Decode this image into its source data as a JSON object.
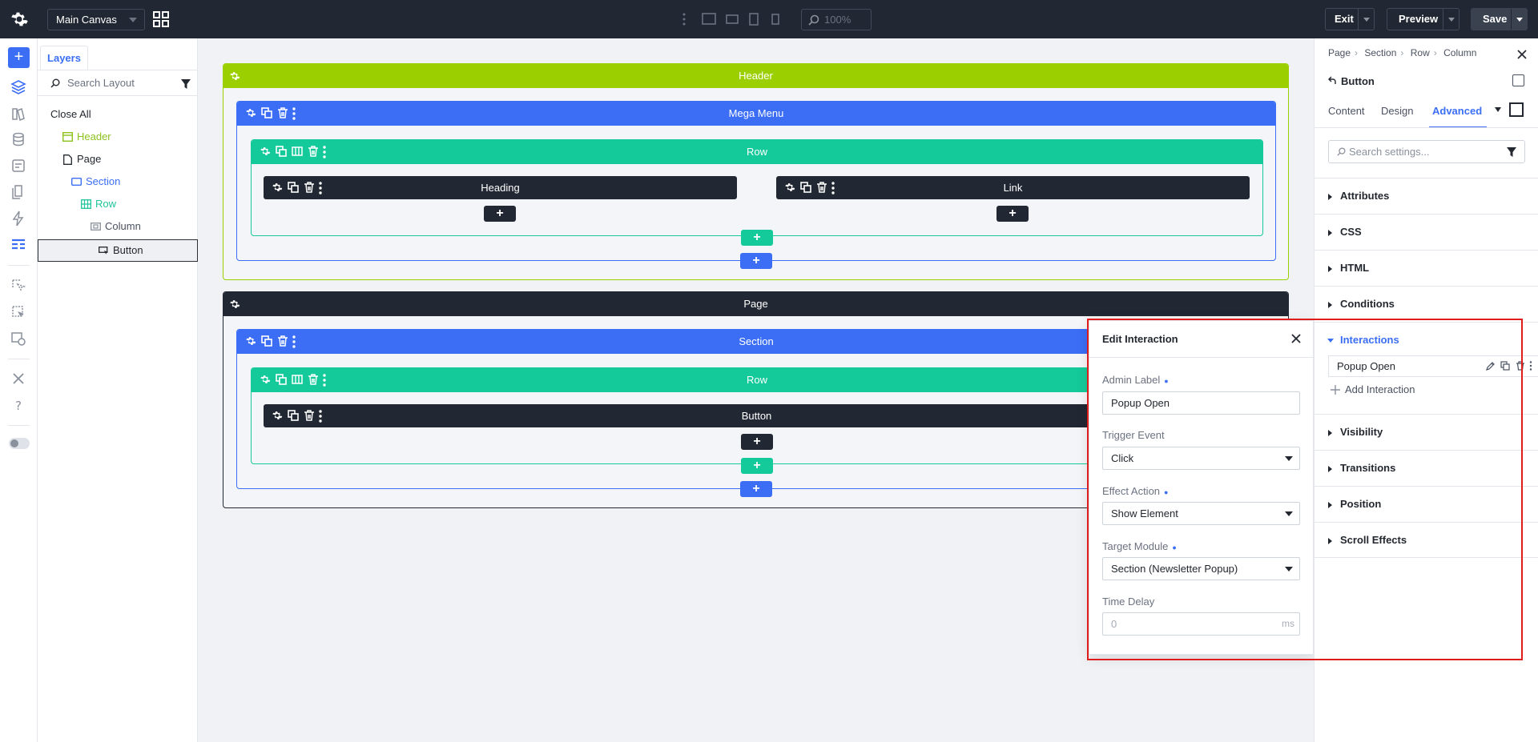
{
  "topbar": {
    "canvas_select": "Main Canvas",
    "zoom": "100%",
    "exit_label": "Exit",
    "preview_label": "Preview",
    "save_label": "Save"
  },
  "layers": {
    "tab_label": "Layers",
    "search_placeholder": "Search Layout",
    "close_all": "Close All",
    "items": [
      {
        "label": "Header",
        "color": "#8dc21f"
      },
      {
        "label": "Page",
        "color": "#23272f"
      },
      {
        "label": "Section",
        "color": "#3b6ef5"
      },
      {
        "label": "Row",
        "color": "#1fc49a"
      },
      {
        "label": "Column",
        "color": "#6b7280"
      },
      {
        "label": "Button",
        "color": "#23272f"
      }
    ]
  },
  "canvas": {
    "header_label": "Header",
    "mega_menu_label": "Mega Menu",
    "row1_label": "Row",
    "heading_label": "Heading",
    "link_label": "Link",
    "page_label": "Page",
    "section_label": "Section",
    "row2_label": "Row",
    "button_label": "Button"
  },
  "popup": {
    "title": "Edit Interaction",
    "admin_label": "Admin Label",
    "admin_value": "Popup Open",
    "trigger_label": "Trigger Event",
    "trigger_value": "Click",
    "effect_label": "Effect Action",
    "effect_value": "Show Element",
    "target_label": "Target Module",
    "target_value": "Section (Newsletter Popup)",
    "delay_label": "Time Delay",
    "delay_placeholder": "0",
    "delay_unit": "ms"
  },
  "rpanel": {
    "breadcrumbs": [
      "Page",
      "Section",
      "Row",
      "Column"
    ],
    "title": "Button",
    "tabs": [
      "Content",
      "Design",
      "Advanced"
    ],
    "search_placeholder": "Search settings...",
    "sections": [
      "Attributes",
      "CSS",
      "HTML",
      "Conditions",
      "Interactions",
      "Visibility",
      "Transitions",
      "Position",
      "Scroll Effects"
    ],
    "interaction_item": "Popup Open",
    "add_interaction": "Add Interaction"
  },
  "colors": {
    "header_bar": "#9ccf00",
    "section_bar": "#3b6ef5",
    "row_bar": "#14c99a",
    "module_bar": "#222833",
    "accent": "#3b6ef5",
    "highlight": "#e01c1c"
  }
}
